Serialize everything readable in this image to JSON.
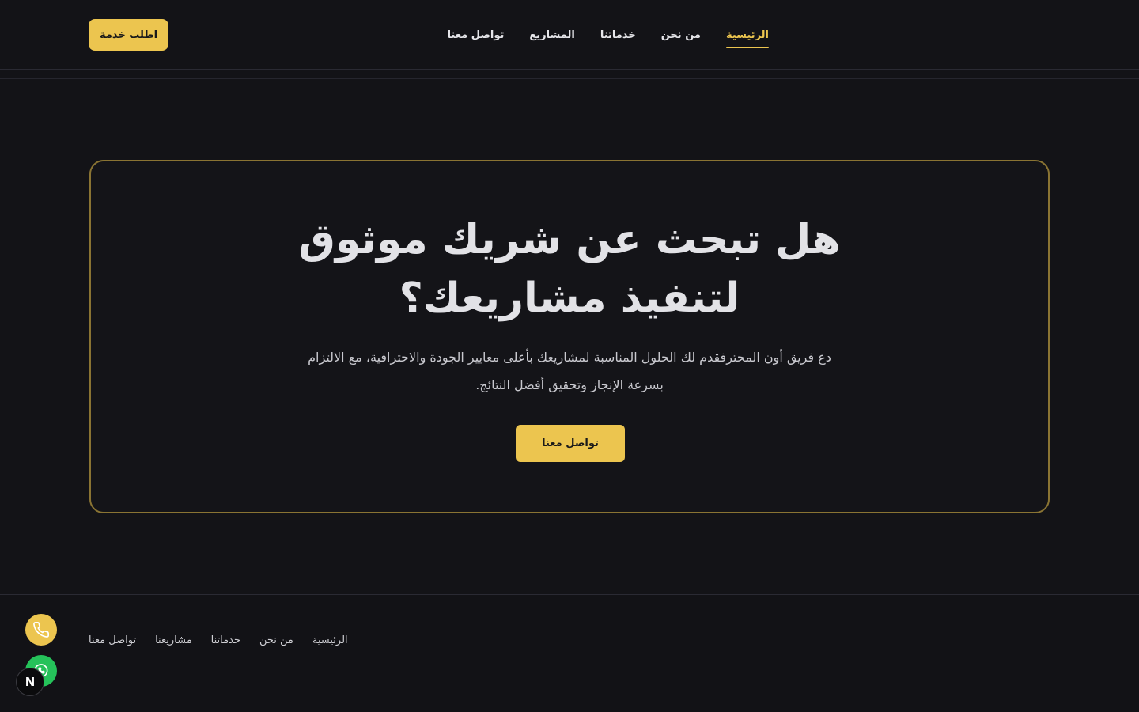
{
  "header": {
    "cta_label": "اطلب خدمة",
    "nav": [
      {
        "label": "الرئيسية",
        "active": true
      },
      {
        "label": "من نحن",
        "active": false
      },
      {
        "label": "خدماتنا",
        "active": false
      },
      {
        "label": "المشاريع",
        "active": false
      },
      {
        "label": "تواصل معنا",
        "active": false
      }
    ]
  },
  "hero": {
    "title": "هل تبحث عن شريك موثوق لتنفيذ مشاريعك؟",
    "description": "دع فريق أون المحترفقدم لك الحلول المناسبة لمشاريعك بأعلى معايير الجودة والاحترافية، مع الالتزام بسرعة الإنجاز وتحقيق أفضل النتائج.",
    "cta_label": "تواصل معنا"
  },
  "footer": {
    "links": [
      {
        "label": "الرئيسية"
      },
      {
        "label": "من نحن"
      },
      {
        "label": "خدماتنا"
      },
      {
        "label": "مشاريعنا"
      },
      {
        "label": "تواصل معنا"
      }
    ]
  },
  "floating": {
    "badge_letter": "N",
    "icons": [
      "phone-icon",
      "whatsapp-icon"
    ]
  },
  "colors": {
    "accent": "#ecc54f",
    "background": "#131317",
    "hero_border": "#8a7433",
    "whatsapp": "#25c25a"
  }
}
